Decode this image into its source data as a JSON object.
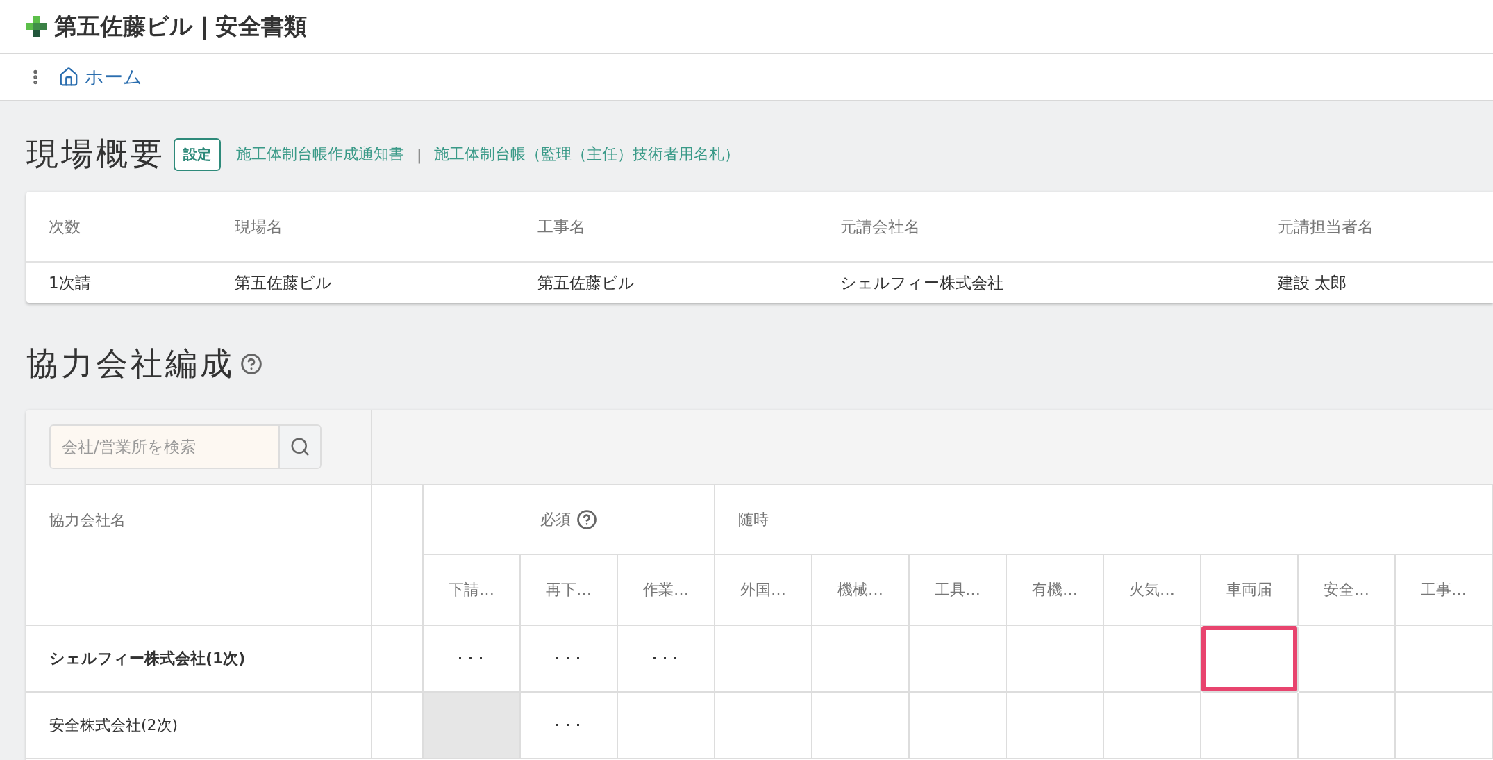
{
  "header": {
    "title": "第五佐藤ビル｜安全書類"
  },
  "breadcrumb": {
    "items": [
      {
        "label": "ホーム"
      }
    ]
  },
  "site_summary": {
    "title": "現場概要",
    "settings_button": "設定",
    "links": [
      "施工体制台帳作成通知書",
      "施工体制台帳（監理（主任）技術者用名札）"
    ],
    "link_separator": "|",
    "columns": [
      "次数",
      "現場名",
      "工事名",
      "元請会社名",
      "元請担当者名"
    ],
    "rows": [
      [
        "1次請",
        "第五佐藤ビル",
        "第五佐藤ビル",
        "シェルフィー株式会社",
        "建設 太郎"
      ]
    ]
  },
  "partners": {
    "title": "協力会社編成",
    "search": {
      "placeholder": "会社/営業所を検索"
    },
    "name_column": "協力会社名",
    "groups": [
      {
        "label": "必須",
        "help": true,
        "documents": [
          "下請…",
          "再下…",
          "作業…"
        ]
      },
      {
        "label": "随時",
        "help": false,
        "documents": [
          "外国…",
          "機械…",
          "工具…",
          "有機…",
          "火気…",
          "車両届",
          "安全…",
          "工事…"
        ]
      }
    ],
    "rows": [
      {
        "name": "シェルフィー株式会社(1次)",
        "primary": true,
        "cells": [
          {
            "text": "･･･",
            "disabled": false,
            "selected": false
          },
          {
            "text": "･･･",
            "disabled": false,
            "selected": false
          },
          {
            "text": "･･･",
            "disabled": false,
            "selected": false
          },
          {
            "disabled": false,
            "selected": false
          },
          {
            "disabled": false,
            "selected": false
          },
          {
            "disabled": false,
            "selected": false
          },
          {
            "disabled": false,
            "selected": false
          },
          {
            "disabled": false,
            "selected": false
          },
          {
            "disabled": false,
            "selected": true
          },
          {
            "disabled": false,
            "selected": false
          },
          {
            "disabled": false,
            "selected": false
          }
        ]
      },
      {
        "name": "安全株式会社(2次)",
        "primary": false,
        "cells": [
          {
            "disabled": true,
            "selected": false
          },
          {
            "text": "･･･",
            "disabled": false,
            "selected": false
          },
          {
            "disabled": false,
            "selected": false
          },
          {
            "disabled": false,
            "selected": false
          },
          {
            "disabled": false,
            "selected": false
          },
          {
            "disabled": false,
            "selected": false
          },
          {
            "disabled": false,
            "selected": false
          },
          {
            "disabled": false,
            "selected": false
          },
          {
            "disabled": false,
            "selected": false
          },
          {
            "disabled": false,
            "selected": false
          },
          {
            "disabled": false,
            "selected": false
          }
        ]
      }
    ]
  }
}
